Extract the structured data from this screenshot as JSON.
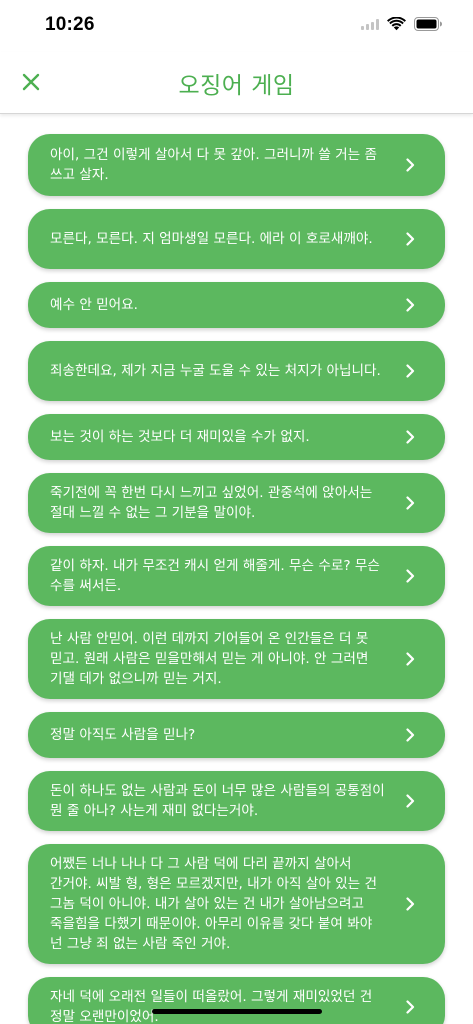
{
  "status_bar": {
    "time": "10:26"
  },
  "header": {
    "title": "오징어 게임",
    "accent": "#4caf50"
  },
  "colors": {
    "card": "#5cb85f",
    "text": "#ffffff"
  },
  "quotes": [
    {
      "text": "아이, 그건 이렇게 살아서 다 못 갚아. 그러니까 쓸 거는 좀 쓰고 살자."
    },
    {
      "text": "모른다, 모른다. 지 엄마생일 모른다. 에라 이 호로새깨야."
    },
    {
      "text": "예수 안 믿어요."
    },
    {
      "text": "죄송한데요, 제가 지금 누굴 도울 수 있는 처지가 아닙니다."
    },
    {
      "text": "보는 것이 하는 것보다 더 재미있을 수가 없지."
    },
    {
      "text": "죽기전에 꼭 한번 다시 느끼고 싶었어. 관중석에 앉아서는 절대 느낄 수 없는 그 기분을 말이야."
    },
    {
      "text": "같이 하자. 내가 무조건 캐시 얻게 해줄게. 무슨 수로? 무슨 수를 써서든."
    },
    {
      "text": "난 사람 안믿어. 이런 데까지 기어들어 온 인간들은 더 못 믿고. 원래 사람은 믿을만해서 믿는 게 아니야. 안 그러면 기댈 데가 없으니까 믿는 거지."
    },
    {
      "text": "정말 아직도 사람을 믿나?"
    },
    {
      "text": "돈이 하나도 없는 사람과 돈이 너무 많은 사람들의 공통점이 뭔 줄 아나? 사는게 재미 없다는거야."
    },
    {
      "text": "어쨌든 너나 나나 다 그 사람 덕에 다리 끝까지 살아서 간거야. 씨발 형, 형은 모르겠지만, 내가 아직 살아 있는 건 그놈 덕이 아니야. 내가 살아 있는 건 내가 살아남으려고 죽을힘을 다했기 때문이야. 아무리 이유를 갖다 붙여 봐야 넌 그냥 죄 없는 사람 죽인 거야."
    },
    {
      "text": "자네 덕에 오래전 일들이 떠올랐어. 그렇게 재미있었던 건 정말 오랜만이었어."
    }
  ]
}
